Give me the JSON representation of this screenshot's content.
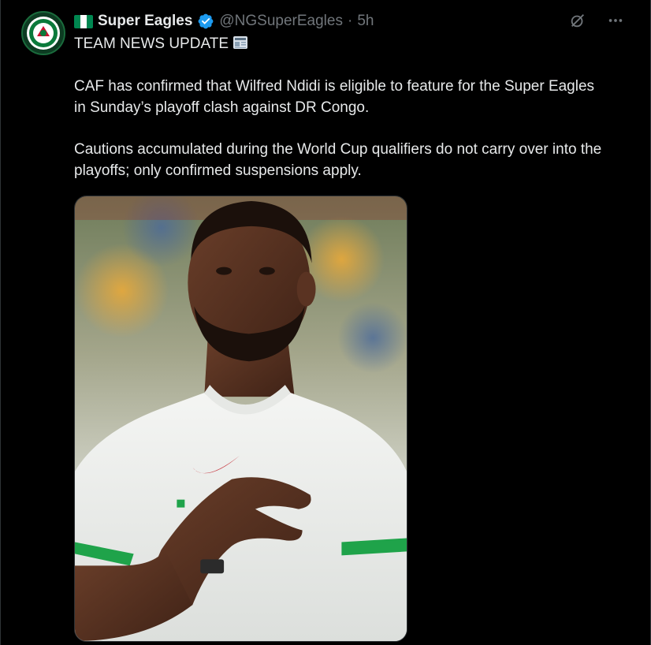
{
  "post": {
    "display_name": "Super Eagles",
    "handle": "@NGSuperEagles",
    "separator": "·",
    "time": "5h",
    "headline": "TEAM NEWS UPDATE",
    "paragraph_1": "CAF has confirmed that Wilfred Ndidi is eligible to feature for the Super Eagles in Sunday’s playoff clash against DR Congo.",
    "paragraph_2": "Cautions accumulated during the World Cup qualifiers do not carry over into the playoffs; only confirmed suspensions apply."
  },
  "icons": {
    "flag": "nigeria-flag-icon",
    "verified": "verified-badge-icon",
    "grok": "grok-icon",
    "more": "more-icon",
    "headline_emoji": "newspaper-icon"
  },
  "colors": {
    "background": "#000000",
    "text": "#e7e9ea",
    "muted": "#71767b",
    "verified": "#1d9bf0",
    "flag_green": "#008751"
  }
}
